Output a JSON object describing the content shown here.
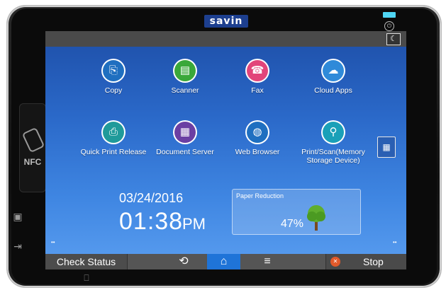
{
  "brand": "savin",
  "nfc": {
    "label": "NFC"
  },
  "apps": [
    {
      "label": "Copy",
      "icon": "copy-icon",
      "glyph": "⎘",
      "color": "#1f6fc0"
    },
    {
      "label": "Scanner",
      "icon": "scanner-icon",
      "glyph": "▤",
      "color": "#3aa83a"
    },
    {
      "label": "Fax",
      "icon": "fax-icon",
      "glyph": "☎",
      "color": "#e2457a"
    },
    {
      "label": "Cloud Apps",
      "icon": "cloud-icon",
      "glyph": "☁",
      "color": "#2f8ad9"
    },
    {
      "label": "Quick Print Release",
      "icon": "quick-print-release-icon",
      "glyph": "⎙",
      "color": "#1f9a9a"
    },
    {
      "label": "Document Server",
      "icon": "document-server-icon",
      "glyph": "▦",
      "color": "#6b3fa3"
    },
    {
      "label": "Web Browser",
      "icon": "globe-icon",
      "glyph": "◍",
      "color": "#1f6fc0"
    },
    {
      "label": "Print/Scan(Memory Storage Device)",
      "icon": "usb-icon",
      "glyph": "⚲",
      "color": "#1aa0b8"
    }
  ],
  "clock": {
    "date": "03/24/2016",
    "time": "01:38",
    "ampm": "PM"
  },
  "paper_reduction": {
    "title": "Paper Reduction",
    "value": "47%"
  },
  "bottom": {
    "check_status": "Check Status",
    "stop": "Stop"
  }
}
